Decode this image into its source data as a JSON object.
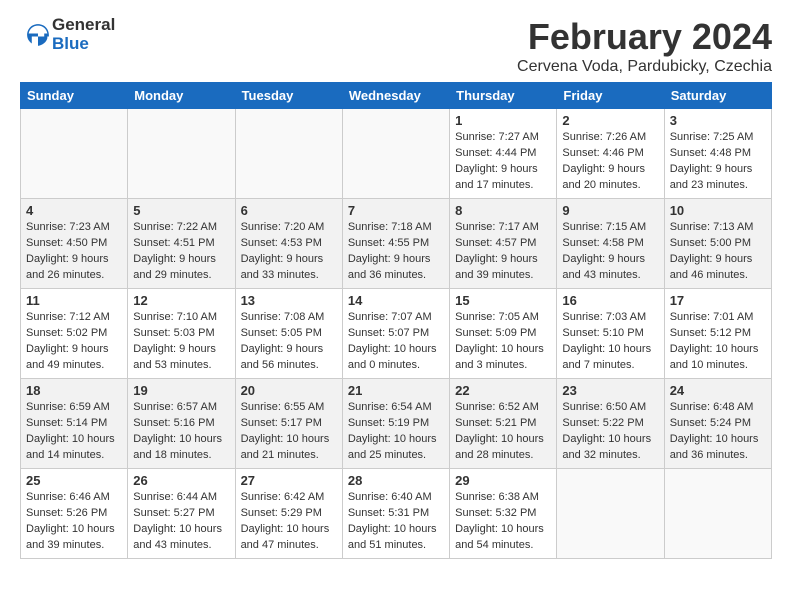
{
  "logo": {
    "general": "General",
    "blue": "Blue"
  },
  "title": "February 2024",
  "location": "Cervena Voda, Pardubicky, Czechia",
  "days_header": [
    "Sunday",
    "Monday",
    "Tuesday",
    "Wednesday",
    "Thursday",
    "Friday",
    "Saturday"
  ],
  "weeks": [
    [
      {
        "num": "",
        "info": ""
      },
      {
        "num": "",
        "info": ""
      },
      {
        "num": "",
        "info": ""
      },
      {
        "num": "",
        "info": ""
      },
      {
        "num": "1",
        "info": "Sunrise: 7:27 AM\nSunset: 4:44 PM\nDaylight: 9 hours\nand 17 minutes."
      },
      {
        "num": "2",
        "info": "Sunrise: 7:26 AM\nSunset: 4:46 PM\nDaylight: 9 hours\nand 20 minutes."
      },
      {
        "num": "3",
        "info": "Sunrise: 7:25 AM\nSunset: 4:48 PM\nDaylight: 9 hours\nand 23 minutes."
      }
    ],
    [
      {
        "num": "4",
        "info": "Sunrise: 7:23 AM\nSunset: 4:50 PM\nDaylight: 9 hours\nand 26 minutes."
      },
      {
        "num": "5",
        "info": "Sunrise: 7:22 AM\nSunset: 4:51 PM\nDaylight: 9 hours\nand 29 minutes."
      },
      {
        "num": "6",
        "info": "Sunrise: 7:20 AM\nSunset: 4:53 PM\nDaylight: 9 hours\nand 33 minutes."
      },
      {
        "num": "7",
        "info": "Sunrise: 7:18 AM\nSunset: 4:55 PM\nDaylight: 9 hours\nand 36 minutes."
      },
      {
        "num": "8",
        "info": "Sunrise: 7:17 AM\nSunset: 4:57 PM\nDaylight: 9 hours\nand 39 minutes."
      },
      {
        "num": "9",
        "info": "Sunrise: 7:15 AM\nSunset: 4:58 PM\nDaylight: 9 hours\nand 43 minutes."
      },
      {
        "num": "10",
        "info": "Sunrise: 7:13 AM\nSunset: 5:00 PM\nDaylight: 9 hours\nand 46 minutes."
      }
    ],
    [
      {
        "num": "11",
        "info": "Sunrise: 7:12 AM\nSunset: 5:02 PM\nDaylight: 9 hours\nand 49 minutes."
      },
      {
        "num": "12",
        "info": "Sunrise: 7:10 AM\nSunset: 5:03 PM\nDaylight: 9 hours\nand 53 minutes."
      },
      {
        "num": "13",
        "info": "Sunrise: 7:08 AM\nSunset: 5:05 PM\nDaylight: 9 hours\nand 56 minutes."
      },
      {
        "num": "14",
        "info": "Sunrise: 7:07 AM\nSunset: 5:07 PM\nDaylight: 10 hours\nand 0 minutes."
      },
      {
        "num": "15",
        "info": "Sunrise: 7:05 AM\nSunset: 5:09 PM\nDaylight: 10 hours\nand 3 minutes."
      },
      {
        "num": "16",
        "info": "Sunrise: 7:03 AM\nSunset: 5:10 PM\nDaylight: 10 hours\nand 7 minutes."
      },
      {
        "num": "17",
        "info": "Sunrise: 7:01 AM\nSunset: 5:12 PM\nDaylight: 10 hours\nand 10 minutes."
      }
    ],
    [
      {
        "num": "18",
        "info": "Sunrise: 6:59 AM\nSunset: 5:14 PM\nDaylight: 10 hours\nand 14 minutes."
      },
      {
        "num": "19",
        "info": "Sunrise: 6:57 AM\nSunset: 5:16 PM\nDaylight: 10 hours\nand 18 minutes."
      },
      {
        "num": "20",
        "info": "Sunrise: 6:55 AM\nSunset: 5:17 PM\nDaylight: 10 hours\nand 21 minutes."
      },
      {
        "num": "21",
        "info": "Sunrise: 6:54 AM\nSunset: 5:19 PM\nDaylight: 10 hours\nand 25 minutes."
      },
      {
        "num": "22",
        "info": "Sunrise: 6:52 AM\nSunset: 5:21 PM\nDaylight: 10 hours\nand 28 minutes."
      },
      {
        "num": "23",
        "info": "Sunrise: 6:50 AM\nSunset: 5:22 PM\nDaylight: 10 hours\nand 32 minutes."
      },
      {
        "num": "24",
        "info": "Sunrise: 6:48 AM\nSunset: 5:24 PM\nDaylight: 10 hours\nand 36 minutes."
      }
    ],
    [
      {
        "num": "25",
        "info": "Sunrise: 6:46 AM\nSunset: 5:26 PM\nDaylight: 10 hours\nand 39 minutes."
      },
      {
        "num": "26",
        "info": "Sunrise: 6:44 AM\nSunset: 5:27 PM\nDaylight: 10 hours\nand 43 minutes."
      },
      {
        "num": "27",
        "info": "Sunrise: 6:42 AM\nSunset: 5:29 PM\nDaylight: 10 hours\nand 47 minutes."
      },
      {
        "num": "28",
        "info": "Sunrise: 6:40 AM\nSunset: 5:31 PM\nDaylight: 10 hours\nand 51 minutes."
      },
      {
        "num": "29",
        "info": "Sunrise: 6:38 AM\nSunset: 5:32 PM\nDaylight: 10 hours\nand 54 minutes."
      },
      {
        "num": "",
        "info": ""
      },
      {
        "num": "",
        "info": ""
      }
    ]
  ]
}
